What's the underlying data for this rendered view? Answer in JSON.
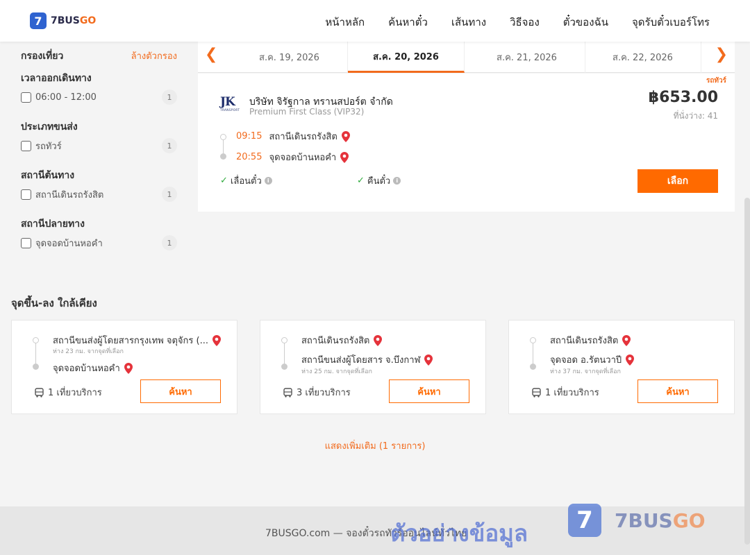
{
  "header": {
    "logo_badge": "7",
    "logo_text_a": "7BUS",
    "logo_text_b": "GO",
    "nav": [
      "หน้าหลัก",
      "ค้นหาตั๋ว",
      "เส้นทาง",
      "วิธีจอง",
      "ตั๋วของฉัน",
      "จุดรับตั๋วเบอร์โทร"
    ]
  },
  "filters": {
    "title": "กรองเที่ยว",
    "clear": "ล้างตัวกรอง",
    "groups": [
      {
        "title": "เวลาออกเดินทาง",
        "option": "06:00 - 12:00",
        "count": "1"
      },
      {
        "title": "ประเภทขนส่ง",
        "option": "รถทัวร์",
        "count": "1"
      },
      {
        "title": "สถานีต้นทาง",
        "option": "สถานีเดินรถรังสิต",
        "count": "1"
      },
      {
        "title": "สถานีปลายทาง",
        "option": "จุดจอดบ้านหอคำ",
        "count": "1"
      }
    ]
  },
  "dates": {
    "tabs": [
      "ส.ค. 19, 2026",
      "ส.ค. 20, 2026",
      "ส.ค. 21, 2026",
      "ส.ค. 22, 2026"
    ],
    "active_index": 1
  },
  "trip": {
    "bus_type": "รถทัวร์",
    "logo_main": "JK",
    "logo_sub": "TRANSPORT",
    "operator": "บริษัท จิรัฐกาล ทรานสปอร์ต จำกัด",
    "class": "Premium First Class (VIP32)",
    "price": "฿653.00",
    "seats": "ที่นั่งว่าง: 41",
    "depart_time": "09:15",
    "depart_station": "สถานีเดินรถรังสิต",
    "arrive_time": "20:55",
    "arrive_station": "จุดจอดบ้านหอคำ",
    "feature_1": "เลื่อนตั๋ว",
    "feature_2": "คืนตั๋ว",
    "select_label": "เลือก"
  },
  "nearby": {
    "title": "จุดขึ้น-ลง ใกล้เคียง",
    "cards": [
      {
        "from": "สถานีขนส่งผู้โดยสารกรุงเทพ จตุจักร (...",
        "from_dist": "ห่าง 23 กม. จากจุดที่เลือก",
        "to": "จุดจอดบ้านหอคำ",
        "to_dist": "",
        "trips": "1 เที่ยวบริการ",
        "button": "ค้นหา"
      },
      {
        "from": "สถานีเดินรถรังสิต",
        "from_dist": "",
        "to": "สถานีขนส่งผู้โดยสาร จ.บึงกาฬ",
        "to_dist": "ห่าง 25 กม. จากจุดที่เลือก",
        "trips": "3 เที่ยวบริการ",
        "button": "ค้นหา"
      },
      {
        "from": "สถานีเดินรถรังสิต",
        "from_dist": "",
        "to": "จุดจอด อ.รัตนวาปี",
        "to_dist": "ห่าง 37 กม. จากจุดที่เลือก",
        "trips": "1 เที่ยวบริการ",
        "button": "ค้นหา"
      }
    ],
    "show_more": "แสดงเพิ่มเติม (1 รายการ)"
  },
  "footer": {
    "text": "7BUSGO.com — จองตั๋วรถทัวร์ออนไลน์ทั่วไทย",
    "watermark": "ตัวอย่างข้อมูล",
    "wm_badge": "7",
    "wm_logo_a": "7BUS",
    "wm_logo_b": "GO"
  },
  "colors": {
    "accent": "#f26b1d",
    "button": "#ff6a00",
    "brand_blue": "#2f63d0",
    "check": "#2eaa3c",
    "pin": "#e5333b"
  }
}
